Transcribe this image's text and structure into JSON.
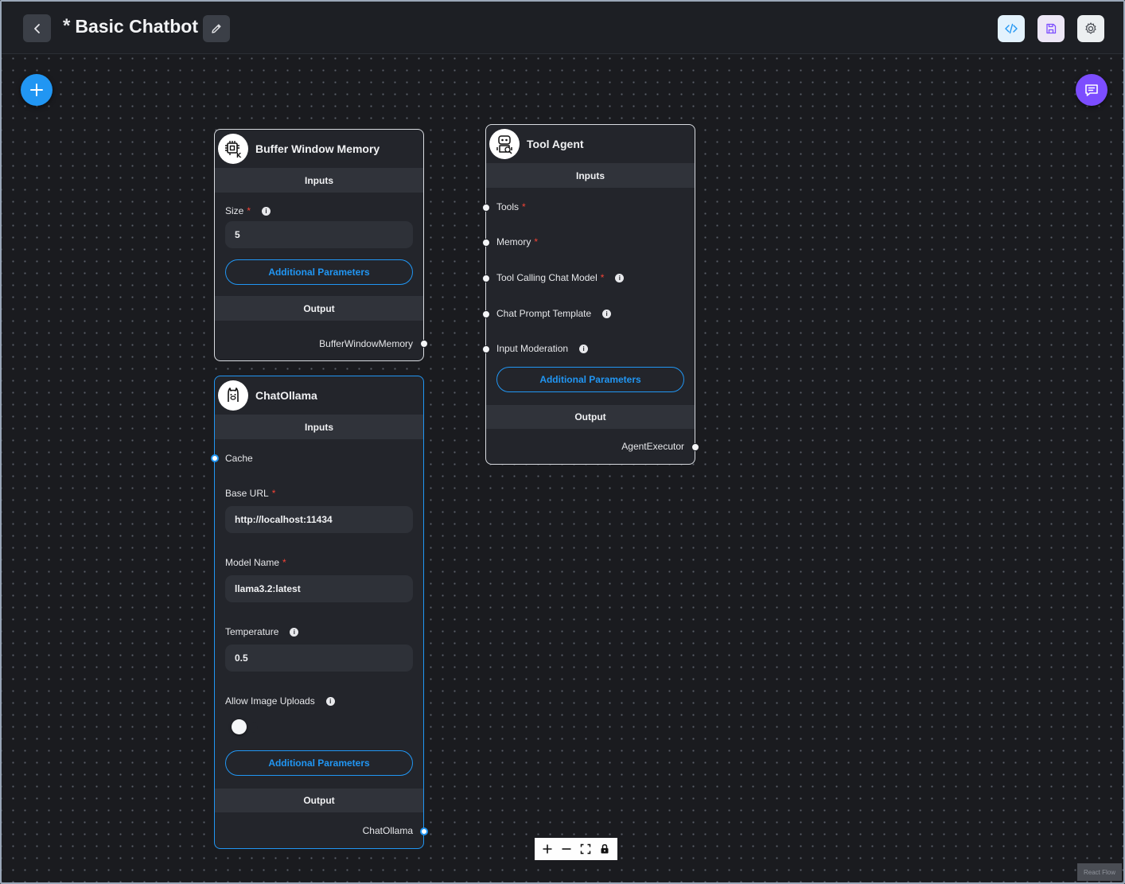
{
  "header": {
    "unsaved_marker": "*",
    "title": "Basic Chatbot"
  },
  "icons": {
    "back": "chevron-left-icon",
    "edit": "pencil-icon",
    "code": "code-icon",
    "save": "save-icon",
    "settings": "gear-icon",
    "add": "plus-icon",
    "chat": "chat-icon"
  },
  "colors": {
    "accent": "#2196f3",
    "chat_fab": "#7c4dff",
    "required": "#f44336",
    "canvas": "#1a1b1f",
    "node": "#23252b"
  },
  "nodes": {
    "buffer_memory": {
      "title": "Buffer Window Memory",
      "inputs_label": "Inputs",
      "size_label": "Size",
      "required_mark": "*",
      "size_value": "5",
      "additional_params": "Additional Parameters",
      "output_label": "Output",
      "output_name": "BufferWindowMemory"
    },
    "chat_ollama": {
      "title": "ChatOllama",
      "inputs_label": "Inputs",
      "cache_label": "Cache",
      "base_url_label": "Base URL",
      "base_url_value": "http://localhost:11434",
      "model_name_label": "Model Name",
      "model_name_value": "llama3.2:latest",
      "temperature_label": "Temperature",
      "temperature_value": "0.5",
      "image_uploads_label": "Allow Image Uploads",
      "image_uploads_enabled": false,
      "required_mark": "*",
      "additional_params": "Additional Parameters",
      "output_label": "Output",
      "output_name": "ChatOllama"
    },
    "tool_agent": {
      "title": "Tool Agent",
      "inputs_label": "Inputs",
      "tools_label": "Tools",
      "memory_label": "Memory",
      "chat_model_label": "Tool Calling Chat Model",
      "prompt_template_label": "Chat Prompt Template",
      "moderation_label": "Input Moderation",
      "required_mark": "*",
      "additional_params": "Additional Parameters",
      "output_label": "Output",
      "output_name": "AgentExecutor"
    }
  },
  "controls": {
    "zoom_in": "plus-icon",
    "zoom_out": "minus-icon",
    "fit_view": "fit-view-icon",
    "lock": "lock-icon"
  },
  "attribution": "React Flow"
}
